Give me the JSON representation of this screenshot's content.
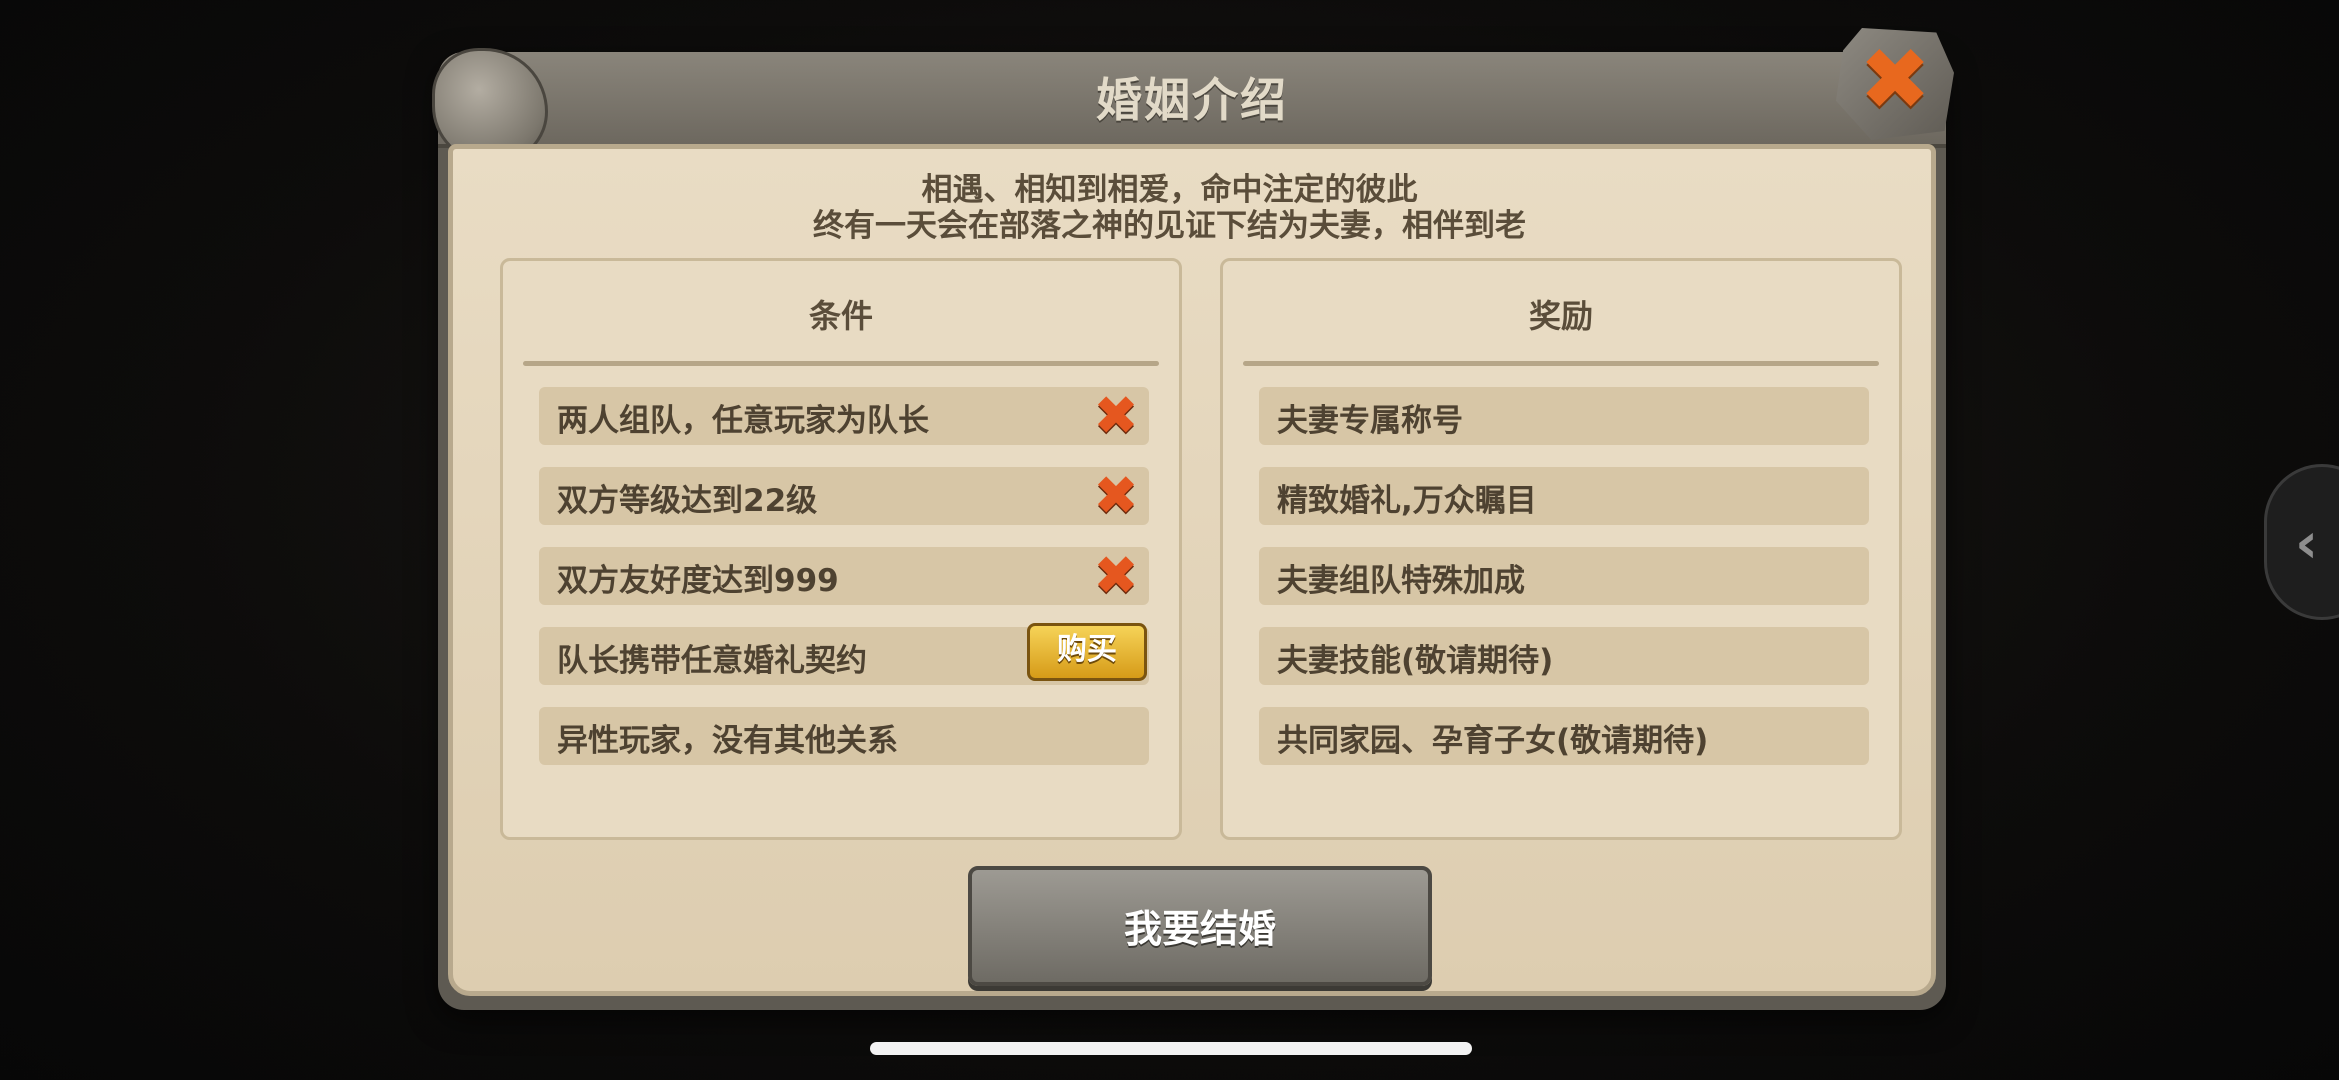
{
  "dialog": {
    "title": "婚姻介绍",
    "intro_line1": "相遇、相知到相爱，命中注定的彼此",
    "intro_line2": "终有一天会在部落之神的见证下结为夫妻，相伴到老",
    "close_icon": "✖"
  },
  "conditions": {
    "title": "条件",
    "items": [
      {
        "label": "两人组队，任意玩家为队长",
        "status": "unmet",
        "icon": "✖"
      },
      {
        "label": "双方等级达到22级",
        "status": "unmet",
        "icon": "✖"
      },
      {
        "label": "双方友好度达到999",
        "status": "unmet",
        "icon": "✖"
      },
      {
        "label": "队长携带任意婚礼契约",
        "status": "buy",
        "button": "购买"
      },
      {
        "label": "异性玩家，没有其他关系",
        "status": "none"
      }
    ]
  },
  "rewards": {
    "title": "奖励",
    "items": [
      {
        "label": "夫妻专属称号"
      },
      {
        "label": "精致婚礼,万众瞩目"
      },
      {
        "label": "夫妻组队特殊加成"
      },
      {
        "label": "夫妻技能(敬请期待)"
      },
      {
        "label": "共同家园、孕育子女(敬请期待)"
      }
    ]
  },
  "actions": {
    "marry_label": "我要结婚"
  },
  "side_tab": {
    "icon": "‹"
  },
  "colors": {
    "accent_x": "#e5571f",
    "buy_gold": "#f6d358",
    "panel": "#e9dcc4"
  }
}
